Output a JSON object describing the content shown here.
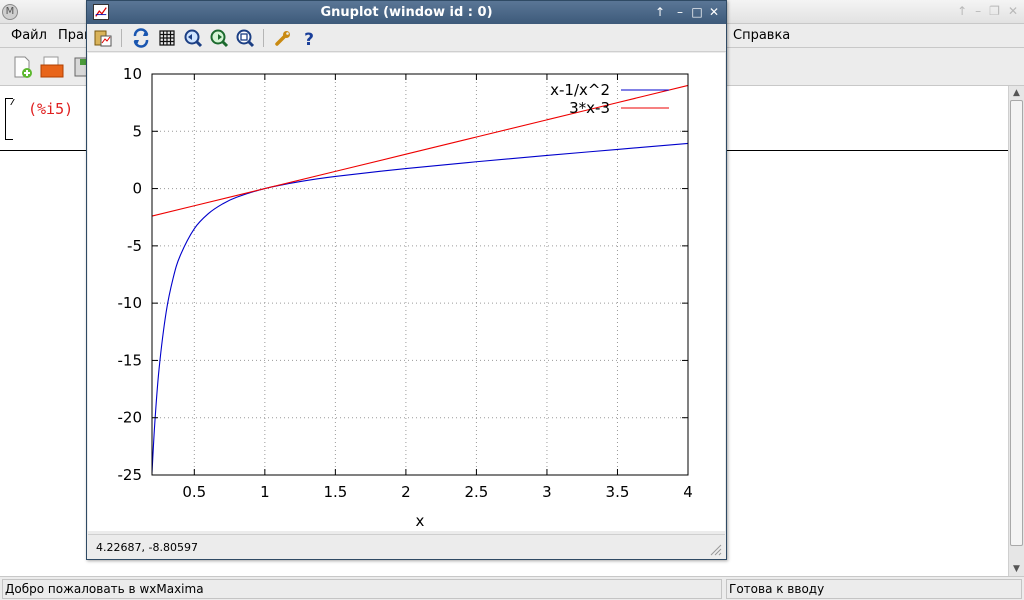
{
  "wxmaxima": {
    "app_icon_glyph": "M",
    "menu": {
      "file": "Файл",
      "edit": "Прав",
      "help": "Справка"
    },
    "toolbar": {
      "new": "new-document-icon",
      "open": "open-folder-icon",
      "save": "save-icon"
    },
    "cell_label": "(%i5)",
    "status_left": "Добро пожаловать в wxMaxima",
    "status_right": "Готова к вводу"
  },
  "gnuplot": {
    "title": "Gnuplot (window id : 0)",
    "titlebar_buttons": {
      "up": "↑",
      "minimize": "–",
      "maximize": "□",
      "close": "✕"
    },
    "toolbar_icons": [
      "copy-clipboard-icon",
      "replot-icon",
      "grid-icon",
      "zoom-previous-icon",
      "zoom-next-icon",
      "autoscale-icon",
      "options-wrench-icon",
      "help-icon"
    ],
    "coordinates": "4.22687, -8.80597"
  },
  "chart_data": {
    "type": "line",
    "title": "",
    "xlabel": "x",
    "ylabel": "",
    "xlim": [
      0.2,
      4
    ],
    "ylim": [
      -25,
      10
    ],
    "xticks": [
      0.5,
      1,
      1.5,
      2,
      2.5,
      3,
      3.5,
      4
    ],
    "xtick_labels": [
      "0.5",
      "1",
      "1.5",
      "2",
      "2.5",
      "3",
      "3.5",
      "4"
    ],
    "yticks": [
      -25,
      -20,
      -15,
      -10,
      -5,
      0,
      5,
      10
    ],
    "ytick_labels": [
      "-25",
      "-20",
      "-15",
      "-10",
      "-5",
      "0",
      "5",
      "10"
    ],
    "grid": true,
    "legend_position": "top-right",
    "series": [
      {
        "name": "x-1/x^2",
        "color": "#0000cc",
        "x": [
          0.2,
          0.22,
          0.25,
          0.3,
          0.35,
          0.4,
          0.5,
          0.6,
          0.7,
          0.8,
          1.0,
          1.25,
          1.5,
          2.0,
          2.5,
          3.0,
          3.5,
          4.0
        ],
        "y": [
          -24.8,
          -20.44,
          -15.75,
          -10.81,
          -7.81,
          -5.85,
          -3.5,
          -2.18,
          -1.34,
          -0.76,
          0.0,
          0.61,
          1.06,
          1.75,
          2.34,
          2.89,
          3.42,
          3.94
        ]
      },
      {
        "name": "3*x-3",
        "color": "#ee0000",
        "x": [
          0.2,
          0.5,
          1.0,
          1.5,
          2.0,
          2.5,
          3.0,
          3.5,
          4.0
        ],
        "y": [
          -2.4,
          -1.5,
          0.0,
          1.5,
          3.0,
          4.5,
          6.0,
          7.5,
          9.0
        ]
      }
    ]
  }
}
